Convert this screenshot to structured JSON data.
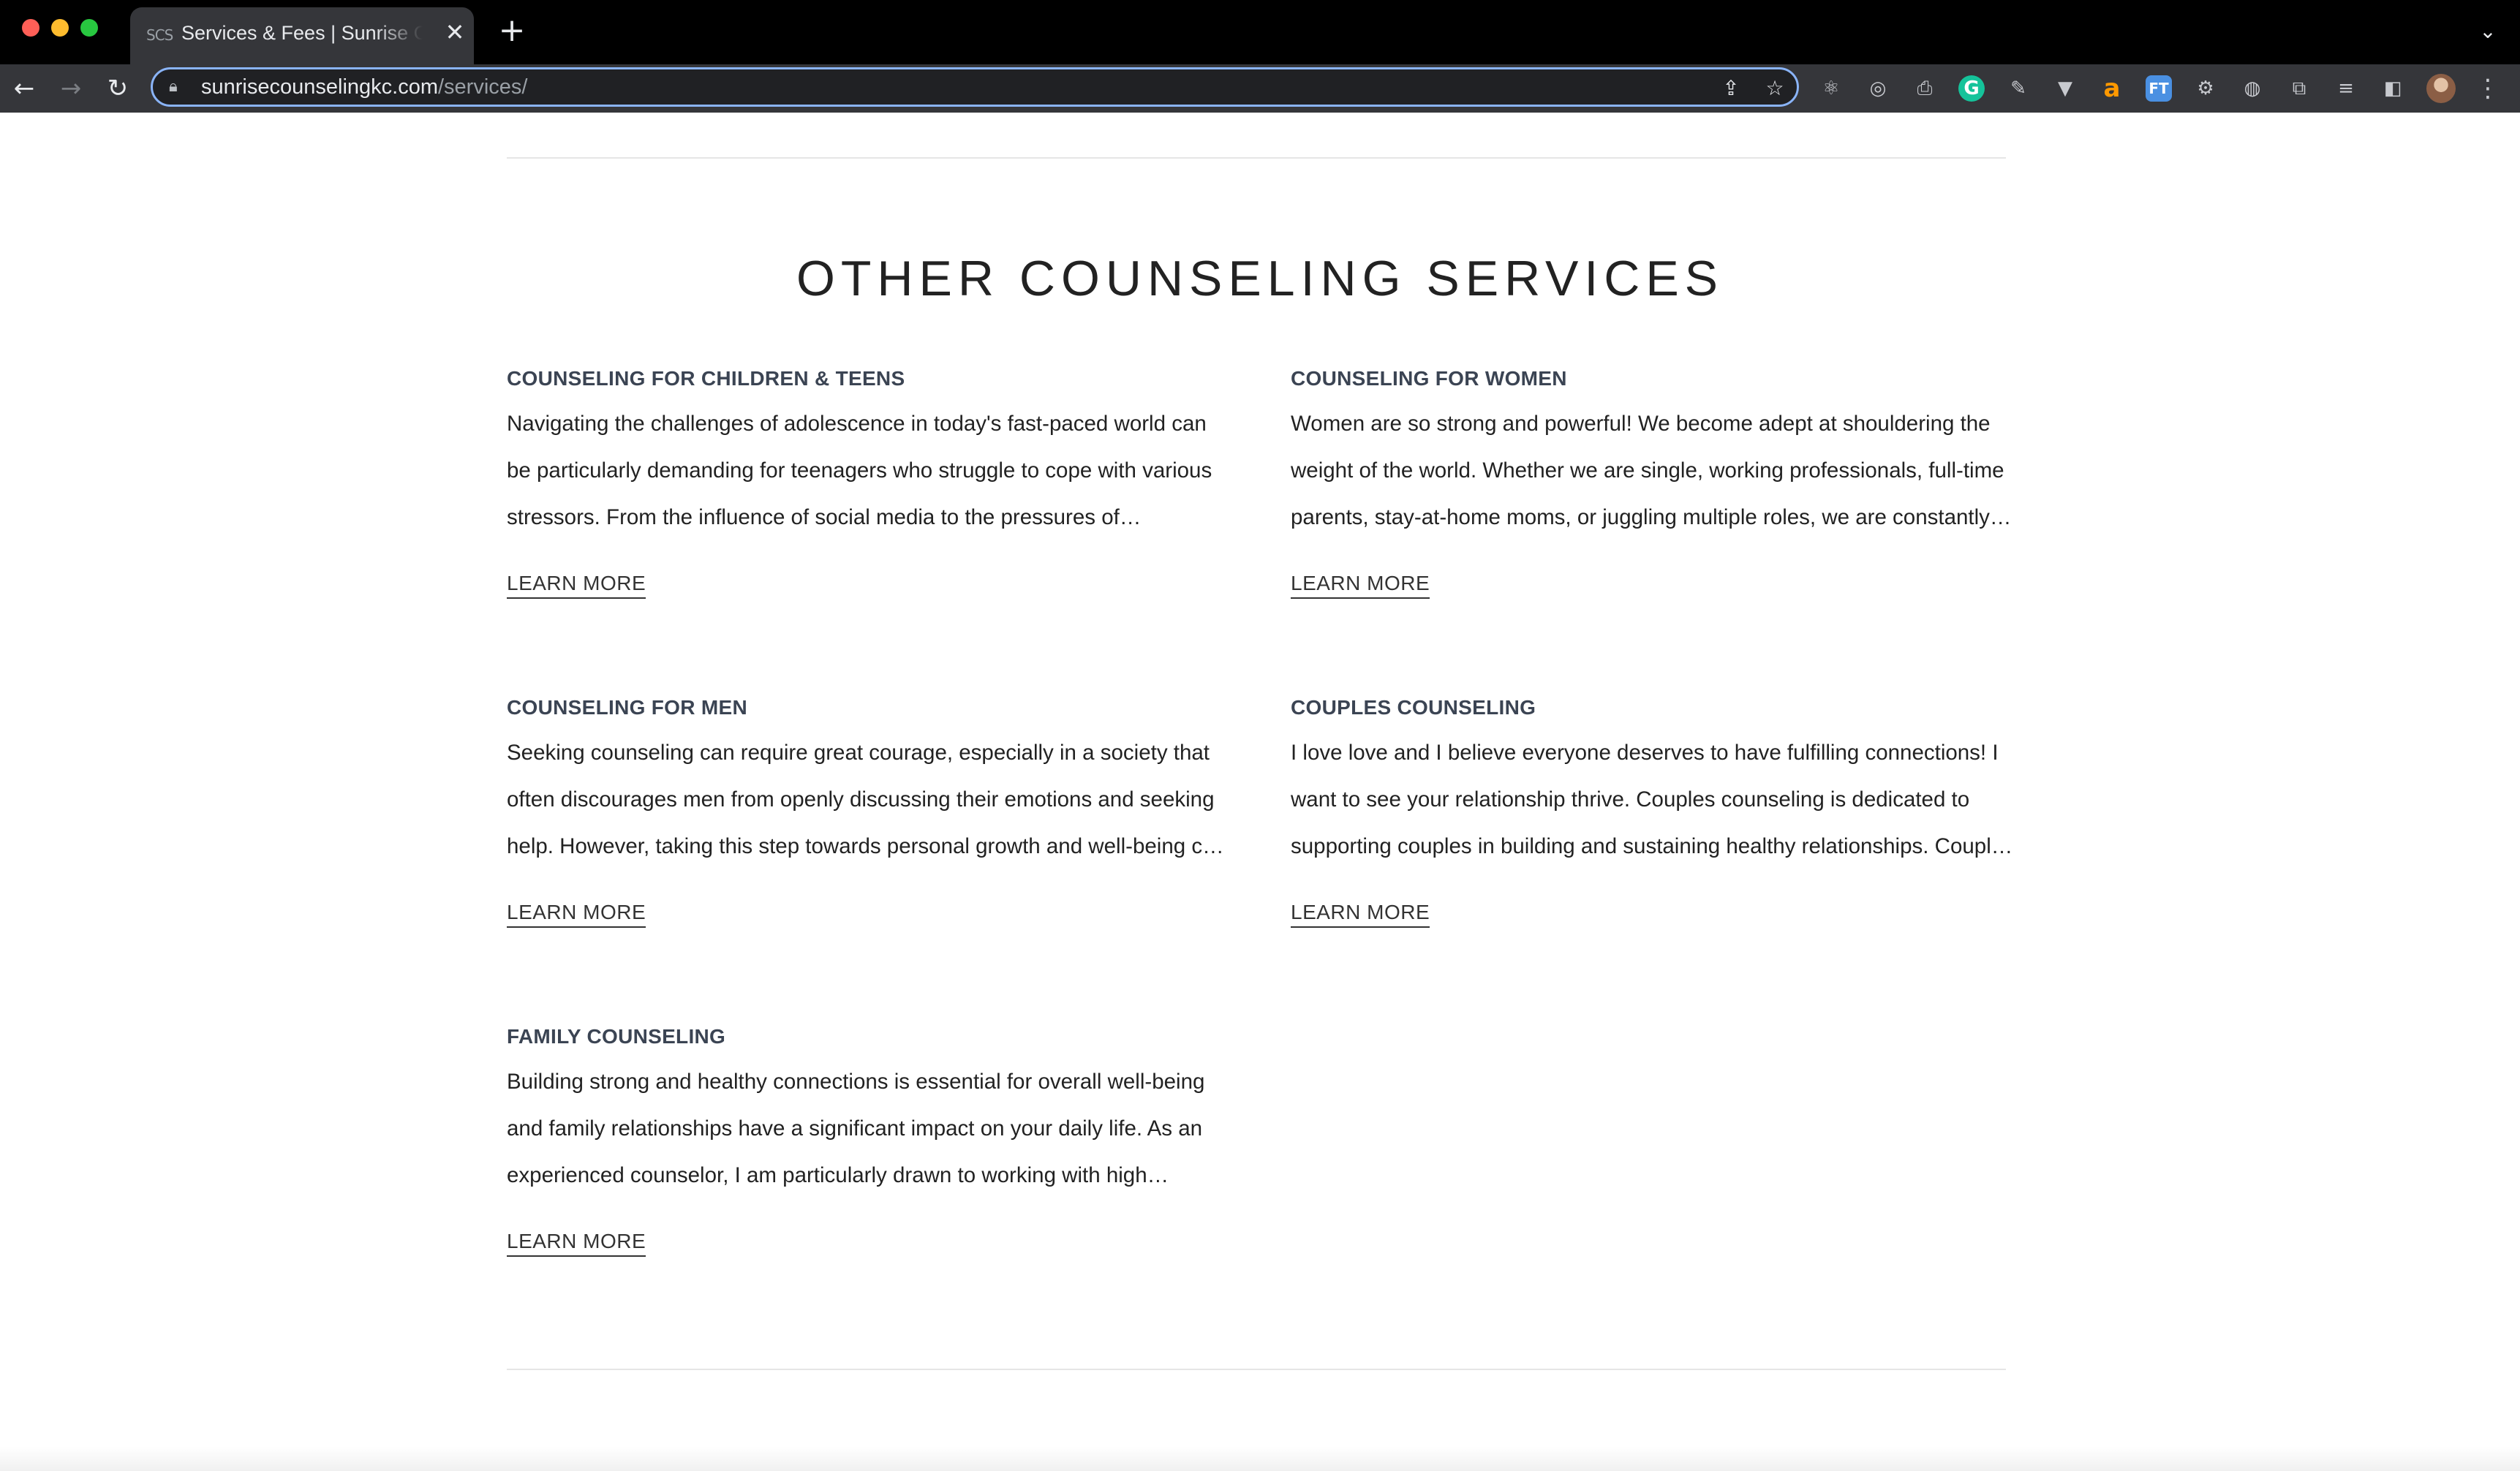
{
  "browser": {
    "tab": {
      "favicon_text": "SCS",
      "title": "Services & Fees | Sunrise Counseling",
      "close": "✕"
    },
    "new_tab": "+",
    "tab_search": "⌄",
    "nav": {
      "back": "←",
      "forward": "→",
      "reload": "↻"
    },
    "omnibox": {
      "host": "sunrisecounselingkc.com",
      "path": "/services/"
    },
    "omnibox_icons": {
      "share": "⇪",
      "bookmark": "☆"
    },
    "extensions": [
      {
        "name": "react-devtools-icon",
        "glyph": "⚛"
      },
      {
        "name": "target-extension-icon",
        "glyph": "◎"
      },
      {
        "name": "printer-extension-icon",
        "glyph": "⎙"
      },
      {
        "name": "grammarly-icon",
        "glyph": "G"
      },
      {
        "name": "color-picker-icon",
        "glyph": "✎"
      },
      {
        "name": "vue-devtools-icon",
        "glyph": "▼"
      },
      {
        "name": "amazon-icon",
        "glyph": "a"
      },
      {
        "name": "ft-extension-icon",
        "glyph": "FT"
      },
      {
        "name": "settings-extension-icon",
        "glyph": "⚙"
      },
      {
        "name": "web-extension-icon",
        "glyph": "◍"
      },
      {
        "name": "extensions-puzzle-icon",
        "glyph": "⧉"
      },
      {
        "name": "reading-list-icon",
        "glyph": "≡"
      },
      {
        "name": "side-panel-icon",
        "glyph": "◧"
      }
    ],
    "menu": "⋮"
  },
  "colors": {
    "chrome_bg": "#000000",
    "toolbar_bg": "#35363a",
    "omnibox_bg": "#202124",
    "focus_ring": "#8ab4f8",
    "heading": "#222222",
    "card_title": "#3b4453",
    "body_text": "#222222",
    "grammarly_green": "#15c39a",
    "amazon_orange": "#ff9900",
    "ft_blue": "#4a90e2"
  },
  "section": {
    "title": "OTHER COUNSELING SERVICES",
    "services": [
      {
        "title": "COUNSELING FOR CHILDREN & TEENS",
        "excerpt": "Navigating the challenges of adolescence in today's fast-paced world can be particularly demanding for teenagers who struggle to cope with various stressors. From the influence of social media to the pressures of academics,…",
        "link": "LEARN MORE"
      },
      {
        "title": "COUNSELING FOR WOMEN",
        "excerpt": "Women are so strong and powerful! We become adept at shouldering the weight of the world. Whether we are single, working professionals, full-time parents, stay-at-home moms, or juggling multiple roles, we are constantly on…",
        "link": "LEARN MORE"
      },
      {
        "title": "COUNSELING FOR MEN",
        "excerpt": "Seeking counseling can require great courage, especially in a society that often discourages men from openly discussing their emotions and seeking help. However, taking this step towards personal growth and well-being can be…",
        "link": "LEARN MORE"
      },
      {
        "title": "COUPLES COUNSELING",
        "excerpt": "I love love and I believe everyone deserves to have fulfilling connections! I want to see your relationship thrive. Couples counseling is dedicated to supporting couples in building and sustaining healthy relationships. Couples can face…",
        "link": "LEARN MORE"
      },
      {
        "title": "FAMILY COUNSELING",
        "excerpt": "Building strong and healthy connections is essential for overall well-being and family relationships have a significant impact on your daily life. As an experienced counselor, I am particularly drawn to working with high conflict…",
        "link": "LEARN MORE"
      }
    ]
  }
}
